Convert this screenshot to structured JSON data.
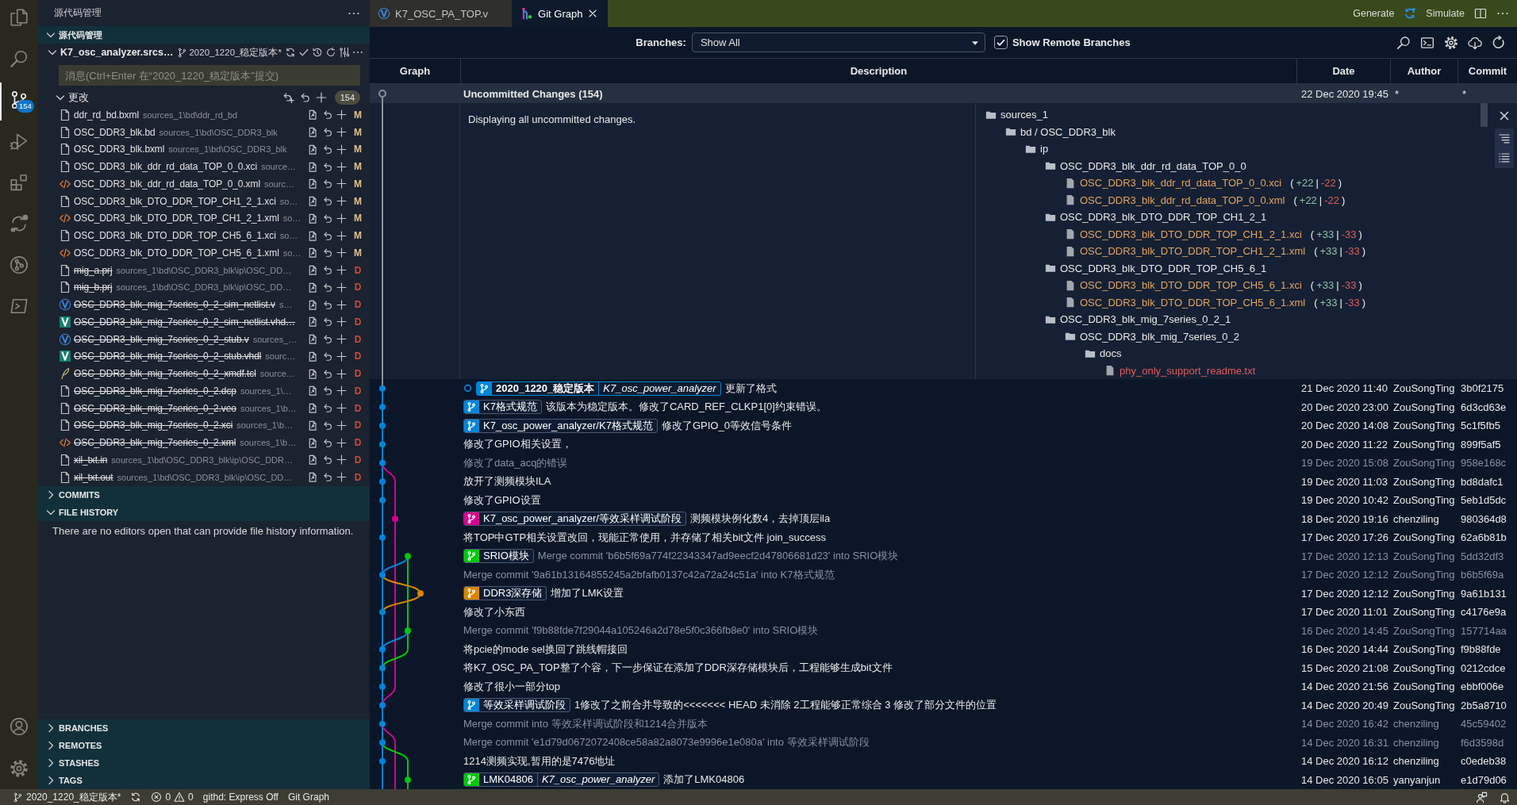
{
  "activity_bar": {
    "items": [
      {
        "kind": "files",
        "selected": false
      },
      {
        "kind": "search",
        "selected": false
      },
      {
        "kind": "source-control",
        "selected": true,
        "badge": "154"
      },
      {
        "kind": "run-debug",
        "selected": false
      },
      {
        "kind": "extensions",
        "selected": false
      },
      {
        "kind": "diff",
        "selected": false
      },
      {
        "kind": "git-graph",
        "selected": false
      },
      {
        "kind": "terminal",
        "selected": false
      }
    ],
    "footer": [
      {
        "kind": "account"
      },
      {
        "kind": "settings"
      }
    ]
  },
  "sidebar": {
    "title": "源代码管理",
    "section": {
      "title": "源代码管理",
      "expanded": true
    },
    "repository": {
      "name": "K7_osc_analyzer.srcs…",
      "branch": "2020_1220_稳定版本*",
      "expanded": true
    },
    "commit_box": {
      "placeholder": "消息(Ctrl+Enter 在“2020_1220_稳定版本”提交)"
    },
    "changes": {
      "title": "更改",
      "count": "154",
      "expanded": true,
      "files": [
        {
          "name": "ddr_rd_bd.bxml",
          "path": "sources_1\\bd\\ddr_rd_bd",
          "status": "M",
          "deleted": false,
          "kind": "file"
        },
        {
          "name": "OSC_DDR3_blk.bd",
          "path": "sources_1\\bd\\OSC_DDR3_blk",
          "status": "M",
          "deleted": false,
          "kind": "file"
        },
        {
          "name": "OSC_DDR3_blk.bxml",
          "path": "sources_1\\bd\\OSC_DDR3_blk",
          "status": "M",
          "deleted": false,
          "kind": "file"
        },
        {
          "name": "OSC_DDR3_blk_ddr_rd_data_TOP_0_0.xci",
          "path": "source…",
          "status": "M",
          "deleted": false,
          "kind": "file"
        },
        {
          "name": "OSC_DDR3_blk_ddr_rd_data_TOP_0_0.xml",
          "path": "sourc…",
          "status": "M",
          "deleted": false,
          "kind": "xml"
        },
        {
          "name": "OSC_DDR3_blk_DTO_DDR_TOP_CH1_2_1.xci",
          "path": "so…",
          "status": "M",
          "deleted": false,
          "kind": "file"
        },
        {
          "name": "OSC_DDR3_blk_DTO_DDR_TOP_CH1_2_1.xml",
          "path": "so…",
          "status": "M",
          "deleted": false,
          "kind": "xml"
        },
        {
          "name": "OSC_DDR3_blk_DTO_DDR_TOP_CH5_6_1.xci",
          "path": "so…",
          "status": "M",
          "deleted": false,
          "kind": "file"
        },
        {
          "name": "OSC_DDR3_blk_DTO_DDR_TOP_CH5_6_1.xml",
          "path": "so…",
          "status": "M",
          "deleted": false,
          "kind": "xml"
        },
        {
          "name": "mig_a.prj",
          "path": "sources_1\\bd\\OSC_DDR3_blk\\ip\\OSC_DD…",
          "status": "D",
          "deleted": true,
          "kind": "file"
        },
        {
          "name": "mig_b.prj",
          "path": "sources_1\\bd\\OSC_DDR3_blk\\ip\\OSC_DD…",
          "status": "D",
          "deleted": true,
          "kind": "file"
        },
        {
          "name": "OSC_DDR3_blk_mig_7series_0_2_sim_netlist.v",
          "path": "s…",
          "status": "D",
          "deleted": true,
          "kind": "verilog"
        },
        {
          "name": "OSC_DDR3_blk_mig_7series_0_2_sim_netlist.vhd…",
          "status": "D",
          "deleted": true,
          "kind": "vhdl"
        },
        {
          "name": "OSC_DDR3_blk_mig_7series_0_2_stub.v",
          "path": "sources_…",
          "status": "D",
          "deleted": true,
          "kind": "verilog"
        },
        {
          "name": "OSC_DDR3_blk_mig_7series_0_2_stub.vhdl",
          "path": "sourc…",
          "status": "D",
          "deleted": true,
          "kind": "vhdl"
        },
        {
          "name": "OSC_DDR3_blk_mig_7series_0_2_xmdf.tcl",
          "path": "source…",
          "status": "D",
          "deleted": true,
          "kind": "tcl"
        },
        {
          "name": "OSC_DDR3_blk_mig_7series_0_2.dcp",
          "path": "sources_1\\…",
          "status": "D",
          "deleted": true,
          "kind": "file"
        },
        {
          "name": "OSC_DDR3_blk_mig_7series_0_2.veo",
          "path": "sources_1\\b…",
          "status": "D",
          "deleted": true,
          "kind": "file"
        },
        {
          "name": "OSC_DDR3_blk_mig_7series_0_2.xci",
          "path": "sources_1\\b…",
          "status": "D",
          "deleted": true,
          "kind": "file"
        },
        {
          "name": "OSC_DDR3_blk_mig_7series_0_2.xml",
          "path": "sources_1\\b…",
          "status": "D",
          "deleted": true,
          "kind": "xml"
        },
        {
          "name": "xil_txt.in",
          "path": "sources_1\\bd\\OSC_DDR3_blk\\ip\\OSC_DDR…",
          "status": "D",
          "deleted": true,
          "kind": "file"
        },
        {
          "name": "xil_txt.out",
          "path": "sources_1\\bd\\OSC_DDR3_blk\\ip\\OSC_DD…",
          "status": "D",
          "deleted": true,
          "kind": "file"
        }
      ]
    },
    "views": [
      {
        "title": "COMMITS",
        "expanded": false
      },
      {
        "title": "FILE HISTORY",
        "expanded": true,
        "message": "There are no editors open that can provide file history information."
      },
      {
        "title": "BRANCHES",
        "expanded": false
      },
      {
        "title": "REMOTES",
        "expanded": false
      },
      {
        "title": "STASHES",
        "expanded": false
      },
      {
        "title": "TAGS",
        "expanded": false
      }
    ]
  },
  "editor": {
    "tabs": [
      {
        "label": "K7_OSC_PA_TOP.v",
        "kind": "verilog",
        "selected": false
      },
      {
        "label": "Git Graph",
        "kind": "git-graph",
        "selected": true
      }
    ],
    "actions": [
      {
        "kind": "text",
        "label": "Generate"
      },
      {
        "kind": "sync"
      },
      {
        "kind": "text",
        "label": "Simulate"
      },
      {
        "kind": "split"
      },
      {
        "kind": "more"
      }
    ]
  },
  "git_graph": {
    "branches": {
      "label": "Branches:",
      "value": "Show All"
    },
    "remote_branches": {
      "label": "Show Remote Branches",
      "checked": true
    },
    "columns": [
      "Graph",
      "Description",
      "Date",
      "Author",
      "Commit"
    ],
    "uncommitted": {
      "title": "Uncommitted Changes (154)",
      "date": "22 Dec 2020 19:45",
      "author": "*",
      "commit": "*",
      "expanded": true,
      "summary": "Displaying all uncommitted changes.",
      "tree": [
        {
          "name": "sources_1",
          "kind": "folder",
          "children": [
            {
              "name": "bd / OSC_DDR3_blk",
              "kind": "folder",
              "children": [
                {
                  "name": "ip",
                  "kind": "folder",
                  "children": [
                    {
                      "name": "OSC_DDR3_blk_ddr_rd_data_TOP_0_0",
                      "kind": "folder",
                      "children": [
                        {
                          "name": "OSC_DDR3_blk_ddr_rd_data_TOP_0_0.xci",
                          "kind": "file",
                          "deleted": false,
                          "diff": {
                            "open": "(",
                            "additions": "+22",
                            "separator": "|",
                            "deletions": "-22",
                            "close": ")"
                          }
                        },
                        {
                          "name": "OSC_DDR3_blk_ddr_rd_data_TOP_0_0.xml",
                          "kind": "file",
                          "deleted": false,
                          "diff": {
                            "open": "(",
                            "additions": "+22",
                            "separator": "|",
                            "deletions": "-22",
                            "close": ")"
                          }
                        }
                      ]
                    },
                    {
                      "name": "OSC_DDR3_blk_DTO_DDR_TOP_CH1_2_1",
                      "kind": "folder",
                      "children": [
                        {
                          "name": "OSC_DDR3_blk_DTO_DDR_TOP_CH1_2_1.xci",
                          "kind": "file",
                          "deleted": false,
                          "diff": {
                            "open": "(",
                            "additions": "+33",
                            "separator": "|",
                            "deletions": "-33",
                            "close": ")"
                          }
                        },
                        {
                          "name": "OSC_DDR3_blk_DTO_DDR_TOP_CH1_2_1.xml",
                          "kind": "file",
                          "deleted": false,
                          "diff": {
                            "open": "(",
                            "additions": "+33",
                            "separator": "|",
                            "deletions": "-33",
                            "close": ")"
                          }
                        }
                      ]
                    },
                    {
                      "name": "OSC_DDR3_blk_DTO_DDR_TOP_CH5_6_1",
                      "kind": "folder",
                      "children": [
                        {
                          "name": "OSC_DDR3_blk_DTO_DDR_TOP_CH5_6_1.xci",
                          "kind": "file",
                          "deleted": false,
                          "diff": {
                            "open": "(",
                            "additions": "+33",
                            "separator": "|",
                            "deletions": "-33",
                            "close": ")"
                          }
                        },
                        {
                          "name": "OSC_DDR3_blk_DTO_DDR_TOP_CH5_6_1.xml",
                          "kind": "file",
                          "deleted": false,
                          "diff": {
                            "open": "(",
                            "additions": "+33",
                            "separator": "|",
                            "deletions": "-33",
                            "close": ")"
                          }
                        }
                      ]
                    },
                    {
                      "name": "OSC_DDR3_blk_mig_7series_0_2_1",
                      "kind": "folder",
                      "children": [
                        {
                          "name": "OSC_DDR3_blk_mig_7series_0_2",
                          "kind": "folder",
                          "children": [
                            {
                              "name": "docs",
                              "kind": "folder",
                              "children": [
                                {
                                  "name": "phy_only_support_readme.txt",
                                  "kind": "file",
                                  "deleted": true
                                }
                              ]
                            }
                          ]
                        }
                      ]
                    }
                  ]
                }
              ]
            }
          ]
        }
      ]
    },
    "commits": [
      {
        "refs": [
          {
            "name": "2020_1220_稳定版本",
            "kind": "head"
          },
          {
            "name": "K7_osc_power_analyzer",
            "kind": "remote"
          }
        ],
        "color": "#0085d9",
        "message": "更新了格式",
        "date": "21 Dec 2020 11:40",
        "author": "ZouSongTing",
        "hash": "3b0f2175",
        "dimmed": false
      },
      {
        "refs": [
          {
            "name": "K7格式规范",
            "kind": "branch"
          }
        ],
        "color": "#0085d9",
        "message": "该版本为稳定版本。修改了CARD_REF_CLKP1[0]约束错误。",
        "date": "20 Dec 2020 23:00",
        "author": "ZouSongTing",
        "hash": "6d3cd63e",
        "dimmed": false
      },
      {
        "refs": [
          {
            "name": "K7_osc_power_analyzer/K7格式规范",
            "kind": "branch"
          }
        ],
        "color": "#0085d9",
        "message": "修改了GPIO_0等效信号条件",
        "date": "20 Dec 2020 14:08",
        "author": "ZouSongTing",
        "hash": "5c1f5fb5",
        "dimmed": false
      },
      {
        "message": "修改了GPIO相关设置，",
        "date": "20 Dec 2020 11:22",
        "author": "ZouSongTing",
        "hash": "899f5af5",
        "dimmed": false
      },
      {
        "message": "修改了data_acq的错误",
        "date": "19 Dec 2020 15:08",
        "author": "ZouSongTing",
        "hash": "958e168c",
        "dimmed": true
      },
      {
        "message": "放开了测频模块ILA",
        "date": "19 Dec 2020 11:03",
        "author": "ZouSongTing",
        "hash": "bd8dafc1",
        "dimmed": false
      },
      {
        "message": "修改了GPIO设置",
        "date": "19 Dec 2020 10:42",
        "author": "ZouSongTing",
        "hash": "5eb1d5dc",
        "dimmed": false
      },
      {
        "refs": [
          {
            "name": "K7_osc_power_analyzer/等效采样调试阶段",
            "kind": "branch"
          }
        ],
        "color": "#d9008f",
        "message": "测频模块例化数4，去掉顶层ila",
        "date": "18 Dec 2020 19:16",
        "author": "chenziling",
        "hash": "980364d8",
        "dimmed": false
      },
      {
        "message": "将TOP中GTP相关设置改回，现能正常使用，并存储了相关bit文件 join_success",
        "date": "17 Dec 2020 17:26",
        "author": "ZouSongTing",
        "hash": "62a6b81b",
        "dimmed": false
      },
      {
        "refs": [
          {
            "name": "SRIO模块",
            "kind": "branch"
          }
        ],
        "color": "#00c80a",
        "message": "Merge commit 'b6b5f69a774f22343347ad9eecf2d47806681d23' into SRIO模块",
        "date": "17 Dec 2020 12:13",
        "author": "ZouSongTing",
        "hash": "5dd32df3",
        "dimmed": true
      },
      {
        "message": "Merge commit '9a61b13164855245a2bfafb0137c42a72a24c51a' into K7格式规范",
        "date": "17 Dec 2020 12:12",
        "author": "ZouSongTing",
        "hash": "b6b5f69a",
        "dimmed": true
      },
      {
        "refs": [
          {
            "name": "DDR3深存储",
            "kind": "branch"
          }
        ],
        "color": "#d98500",
        "message": "增加了LMK设置",
        "date": "17 Dec 2020 12:12",
        "author": "ZouSongTing",
        "hash": "9a61b131",
        "dimmed": false
      },
      {
        "message": "修改了小东西",
        "date": "17 Dec 2020 11:01",
        "author": "ZouSongTing",
        "hash": "c4176e9a",
        "dimmed": false
      },
      {
        "message": "Merge commit 'f9b88fde7f29044a105246a2d78e5f0c366fb8e0' into SRIO模块",
        "date": "16 Dec 2020 14:45",
        "author": "ZouSongTing",
        "hash": "157714aa",
        "dimmed": true
      },
      {
        "message": "将pcie的mode sel换回了跳线帽接回",
        "date": "16 Dec 2020 14:44",
        "author": "ZouSongTing",
        "hash": "f9b88fde",
        "dimmed": false
      },
      {
        "message": "将K7_OSC_PA_TOP整了个容，下一步保证在添加了DDR深存储模块后，工程能够生成bit文件",
        "date": "15 Dec 2020 21:08",
        "author": "ZouSongTing",
        "hash": "0212cdce",
        "dimmed": false
      },
      {
        "message": "修改了很小一部分top",
        "date": "14 Dec 2020 21:56",
        "author": "ZouSongTing",
        "hash": "ebbf006e",
        "dimmed": false
      },
      {
        "refs": [
          {
            "name": "等效采样调试阶段",
            "kind": "branch"
          }
        ],
        "color": "#0085d9",
        "message": "1修改了之前合并导致的<<<<<<< HEAD 未消除 2工程能够正常综合 3 修改了部分文件的位置",
        "date": "14 Dec 2020 20:49",
        "author": "ZouSongTing",
        "hash": "2b5a8710",
        "dimmed": false
      },
      {
        "message": "Merge commit into 等效采样调试阶段和1214合并版本",
        "date": "14 Dec 2020 16:42",
        "author": "chenziling",
        "hash": "45c59402",
        "dimmed": true
      },
      {
        "message": "Merge commit 'e1d79d0672072408ce58a82a8073e9996e1e080a' into 等效采样调试阶段",
        "date": "14 Dec 2020 16:31",
        "author": "chenziling",
        "hash": "f6d3598d",
        "dimmed": true
      },
      {
        "message": "1214测频实现,暂用的是7476地址",
        "date": "14 Dec 2020 16:12",
        "author": "chenziling",
        "hash": "c0edeb38",
        "dimmed": false
      },
      {
        "refs": [
          {
            "name": "LMK04806",
            "kind": "branch"
          },
          {
            "name": "K7_osc_power_analyzer",
            "kind": "remote"
          }
        ],
        "color": "#00c80a",
        "message": "添加了LMK04806",
        "date": "14 Dec 2020 16:05",
        "author": "yanyanjun",
        "hash": "e1d79d06",
        "dimmed": false
      }
    ]
  },
  "status_bar": {
    "branch": "2020_1220_稳定版本*",
    "errors": "0",
    "warnings": "0",
    "items": [
      "githd: Express Off",
      "Git Graph"
    ]
  }
}
